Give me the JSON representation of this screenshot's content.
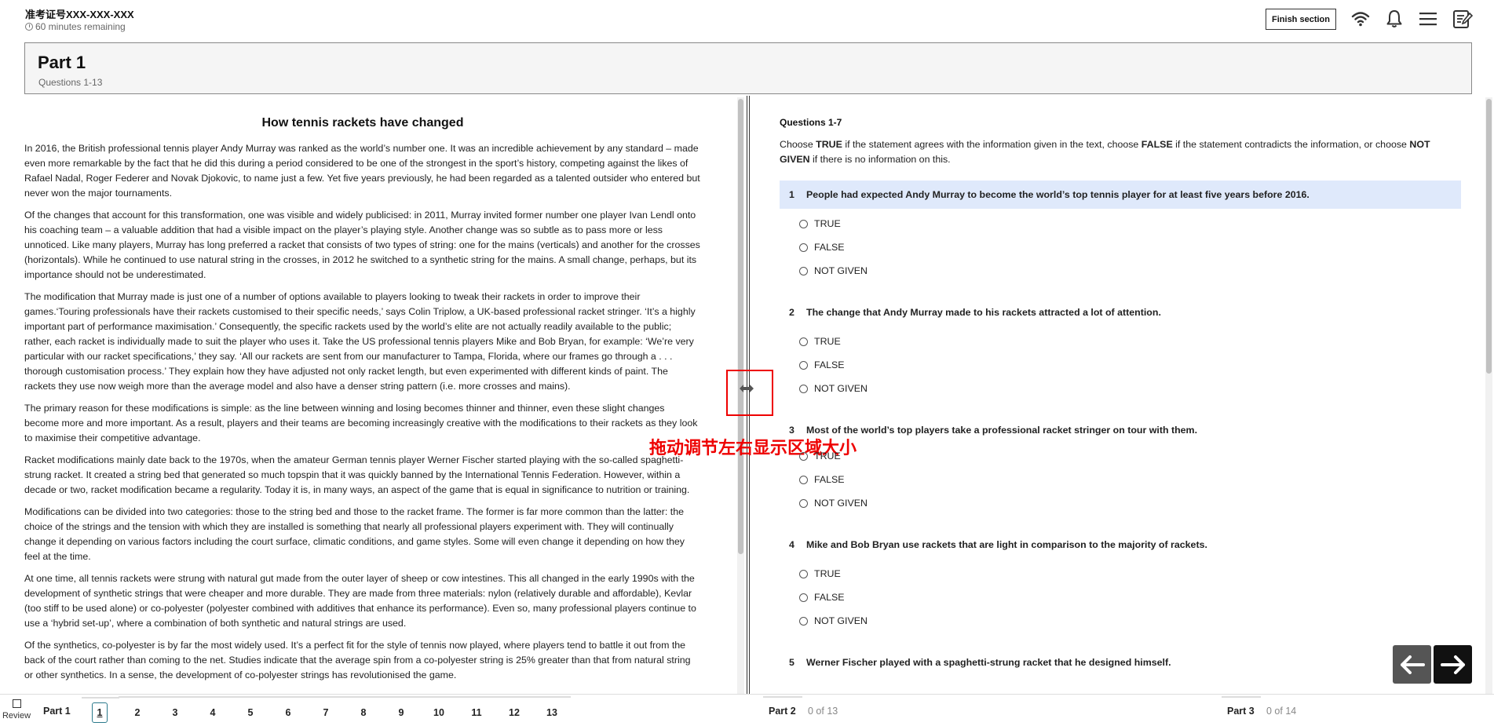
{
  "header": {
    "candidate_id": "准考证号XXX-XXX-XXX",
    "time_remaining": "60 minutes remaining",
    "finish_label": "Finish section",
    "icons": [
      "wifi-icon",
      "bell-icon",
      "menu-icon",
      "notes-icon"
    ]
  },
  "part": {
    "title": "Part 1",
    "subtitle": "Questions 1-13"
  },
  "passage": {
    "title": "How tennis rackets have changed",
    "paragraphs": [
      "In 2016, the British professional tennis player Andy Murray was ranked as the world’s number one. It was an incredible achievement by any standard – made even more remarkable by the fact that he did this during a period considered to be one of the strongest in the sport’s history, competing against the likes of Rafael Nadal, Roger Federer and Novak Djokovic, to name just a  few. Yet five years previously, he had been regarded as a talented outsider who entered but never won the major tournaments.",
      "Of the changes that account for this transformation, one was visible and widely publicised: in 2011, Murray invited former number one player Ivan Lendl onto his coaching team – a valuable addition that had a visible impact on the player’s playing style. Another change was so subtle as to pass more or less unnoticed. Like many players, Murray has long preferred a racket that consists of two types of string: one for the mains (verticals) and another for the crosses (horizontals). While he continued to use natural string in the crosses, in 2012 he switched to a synthetic string for the mains. A small change, perhaps, but its importance should not be underestimated.",
      "The modification that Murray made is just one of a number of options available to players looking to tweak their rackets in order to improve their games.‘Touring professionals have their rackets customised to their specific needs,’ says Colin Triplow, a UK-based professional racket stringer. ‘It’s a highly important part of performance maximisation.’ Consequently, the specific rackets used by the world’s elite are not actually readily available to the public; rather, each racket is individually made to suit the player who uses it. Take the US professional tennis players Mike and Bob Bryan, for example: ‘We’re very particular with our racket specifications,’ they say. ‘All our rackets are sent from our manufacturer to Tampa, Florida, where our frames go through a . . . thorough customisation process.’ They explain how they have adjusted not only racket length, but even experimented with different kinds of paint.  The rackets they use now weigh more than the average model and also have a denser string pattern (i.e. more crosses and mains).",
      "The primary reason for these modifications is simple: as the line between winning and losing becomes thinner and thinner, even these slight changes become more and more important. As a result, players and their teams are becoming increasingly creative with the modifications to their rackets as they look to maximise their competitive advantage.",
      "Racket modifications mainly date back to the 1970s, when the amateur German tennis player Werner Fischer started playing with the so-called spaghetti-strung racket. It created a string bed that generated so much topspin that it was quickly banned by the International Tennis Federation. However, within a decade or two, racket modification became a regularity.   Today it is, in many ways, an aspect of the game that is equal in significance to nutrition or training.",
      "Modifications can be divided into two categories: those to the string bed and those to the racket frame. The former is far more common than the latter: the choice of the strings and the tension with which they are installed is something that nearly all professional players experiment with. They will continually change it depending on various factors including the court surface, climatic conditions, and game styles. Some will even change it depending on how they feel at the time.",
      "At one time, all tennis rackets were strung with natural gut made from the outer layer of sheep or cow intestines.   This all changed in the early 1990s with the development of synthetic strings that were cheaper and more durable. They are made from three materials: nylon (relatively durable and affordable), Kevlar (too stiff to be used alone) or co-polyester (polyester combined with additives that enhance its performance). Even so, many professional players continue to use a ‘hybrid set-up’, where a combination of both synthetic and natural strings are used.",
      "Of the synthetics, co-polyester is by far the most widely used. It’s a perfect fit for the style of tennis now played, where players tend to battle it out from the back of the court rather than coming to the net. Studies indicate that the average spin from a co-polyester string is 25% greater than that from natural string or other synthetics. In a sense, the development of co-polyester strings has revolutionised the game."
    ]
  },
  "overlay": {
    "drag_hint": "拖动调节左右显示区域大小"
  },
  "questions": {
    "range": "Questions 1-7",
    "instr_1": "Choose ",
    "instr_true": "TRUE",
    "instr_2": " if the statement agrees with the information given in the text, choose ",
    "instr_false": "FALSE",
    "instr_3": " if the statement contradicts the information, or choose ",
    "instr_ng": "NOT GIVEN",
    "instr_4": " if there is no information on this.",
    "options": [
      "TRUE",
      "FALSE",
      "NOT GIVEN"
    ],
    "items": [
      {
        "num": "1",
        "text": "People had expected Andy Murray to become the world’s top tennis player for at least five years before 2016."
      },
      {
        "num": "2",
        "text": "The change that Andy Murray made to his rackets attracted a lot of attention."
      },
      {
        "num": "3",
        "text": "Most of the world’s top players take a professional racket stringer on tour with them."
      },
      {
        "num": "4",
        "text": "Mike and Bob Bryan use rackets that are light in comparison to the majority of rackets."
      },
      {
        "num": "5",
        "text": "Werner Fischer played with a spaghetti-strung racket that he designed himself."
      }
    ]
  },
  "footer": {
    "review_label": "Review",
    "part1_label": "Part 1",
    "part1_questions": [
      "1",
      "2",
      "3",
      "4",
      "5",
      "6",
      "7",
      "8",
      "9",
      "10",
      "11",
      "12",
      "13"
    ],
    "part2_label": "Part 2",
    "part2_count": "0 of 13",
    "part3_label": "Part 3",
    "part3_count": "0 of 14"
  }
}
